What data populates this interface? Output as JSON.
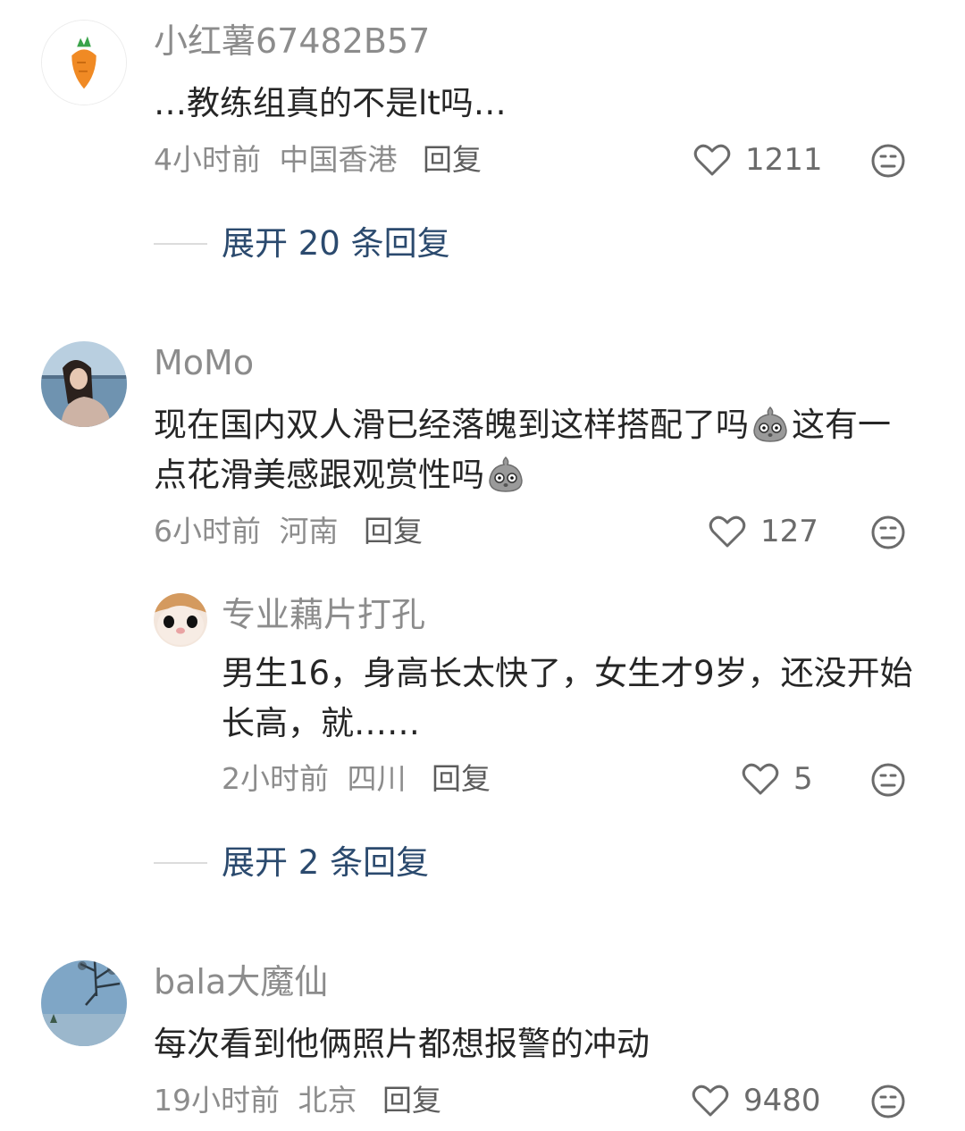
{
  "comments": [
    {
      "username": "小红薯67482B57",
      "text": "…教练组真的不是lt吗…",
      "time": "4小时前",
      "location": "中国香港",
      "reply_label": "回复",
      "likes": "1211",
      "avatar_icon": "carrot-icon",
      "expand_label": "展开 20 条回复"
    },
    {
      "username": "MoMo",
      "text_part1": "现在国内双人滑已经落魄到这样搭配了吗",
      "text_part2": "这有一点花滑美感跟观赏性吗",
      "emoji_icon": "shocked-potato-emoji",
      "time": "6小时前",
      "location": "河南",
      "reply_label": "回复",
      "likes": "127",
      "avatar_icon": "woman-lake-photo",
      "replies": [
        {
          "username": "专业藕片打孔",
          "text": "男生16，身高长太快了，女生才9岁，还没开始长高，就……",
          "time": "2小时前",
          "location": "四川",
          "reply_label": "回复",
          "likes": "5",
          "avatar_icon": "cat-face-photo"
        }
      ],
      "expand_label": "展开 2 条回复"
    },
    {
      "username": "bala大魔仙",
      "text": "每次看到他俩照片都想报警的冲动",
      "time": "19小时前",
      "location": "北京",
      "reply_label": "回复",
      "likes": "9480",
      "avatar_icon": "tree-sky-photo"
    }
  ],
  "colors": {
    "username": "#8c8c8c",
    "text": "#262626",
    "expand": "#2b4a6e"
  }
}
